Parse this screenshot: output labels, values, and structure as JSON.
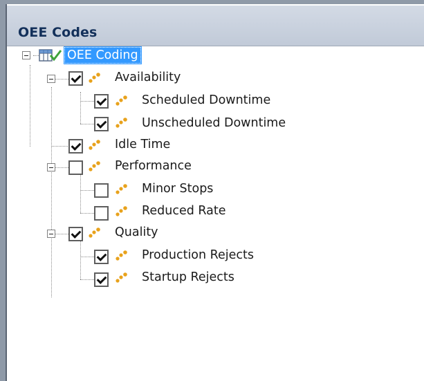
{
  "panel": {
    "title": "OEE Codes"
  },
  "tree": {
    "root": {
      "label": "OEE Coding",
      "expanded": true,
      "selected": true
    },
    "nodes": [
      {
        "label": "Availability",
        "checked": true,
        "level": 1,
        "expanded": true
      },
      {
        "label": "Scheduled Downtime",
        "checked": true,
        "level": 2
      },
      {
        "label": "Unscheduled Downtime",
        "checked": true,
        "level": 2
      },
      {
        "label": "Idle Time",
        "checked": true,
        "level": 1
      },
      {
        "label": "Performance",
        "checked": false,
        "level": 1,
        "expanded": true
      },
      {
        "label": "Minor Stops",
        "checked": false,
        "level": 2
      },
      {
        "label": "Reduced Rate",
        "checked": false,
        "level": 2
      },
      {
        "label": "Quality",
        "checked": true,
        "level": 1,
        "expanded": true
      },
      {
        "label": "Production Rejects",
        "checked": true,
        "level": 2
      },
      {
        "label": "Startup Rejects",
        "checked": true,
        "level": 2
      }
    ]
  },
  "colors": {
    "header_text": "#13305a",
    "selection": "#3399ff",
    "node_icon": "#e8a21c"
  },
  "icons": {
    "node": "orange-dots-icon",
    "root": "grid-check-icon"
  }
}
